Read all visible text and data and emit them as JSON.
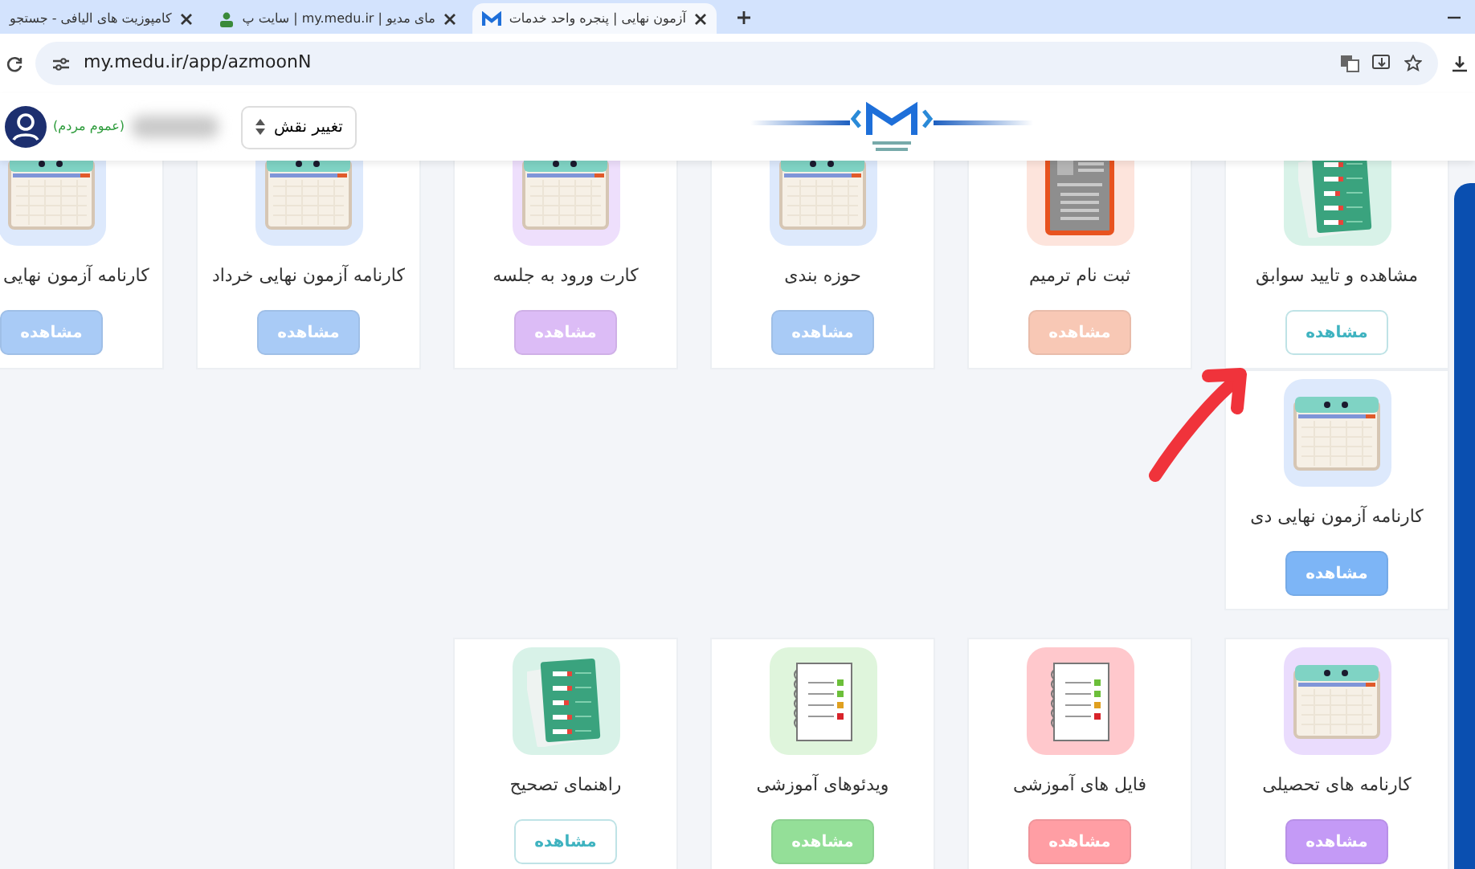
{
  "browser": {
    "tabs": [
      {
        "title": "آزمون نهایی | پنجره واحد خدمات",
        "selected": true,
        "kind": "logo"
      },
      {
        "title": "مای مدیو | my.medu.ir | سایت پ",
        "selected": false,
        "kind": "person"
      },
      {
        "title": "کامپوزیت های الیافی - جستجو",
        "selected": false,
        "kind": "plain"
      }
    ],
    "address_bar": {
      "url": "my.medu.ir/app/azmoonN"
    }
  },
  "header": {
    "user_role": "(عموم مردم)",
    "role_button": "تغییر نقش"
  },
  "card_rows": [
    {
      "cards": [
        {
          "title": "مشاهده و تایید سوابق",
          "icon": {
            "kind": "checklist"
          },
          "color": "#d8f2e8",
          "button": {
            "label": "مشاهده",
            "kind": "outline",
            "color": "#3fb3c0"
          }
        },
        {
          "title": "ثبت نام ترمیم",
          "icon": {
            "kind": "report"
          },
          "color": "#fde4dc",
          "button": {
            "label": "مشاهده",
            "kind": "filled",
            "color": "#f8c8b5"
          }
        },
        {
          "title": "حوزه بندی",
          "icon": {
            "kind": "calendar"
          },
          "color": "#dde9fc",
          "button": {
            "label": "مشاهده",
            "kind": "filled",
            "color": "#a9cbf6"
          }
        },
        {
          "title": "کارت ورود به جلسه",
          "icon": {
            "kind": "calendar"
          },
          "color": "#eedffc",
          "button": {
            "label": "مشاهده",
            "kind": "filled",
            "color": "#dcbcf6"
          }
        },
        {
          "title": "کارنامه آزمون نهایی خرداد",
          "icon": {
            "kind": "calendar"
          },
          "color": "#dde9fc",
          "button": {
            "label": "مشاهده",
            "kind": "filled",
            "color": "#a9cbf6"
          }
        },
        {
          "title": "کارنامه آزمون نهایی",
          "icon": {
            "kind": "calendar"
          },
          "color": "#dde9fc",
          "button": {
            "label": "مشاهده",
            "kind": "filled",
            "color": "#a9cbf6"
          }
        }
      ]
    },
    {
      "cards": [
        {
          "title": "کارنامه آزمون نهایی دی",
          "icon": {
            "kind": "calendar"
          },
          "color": "#dde9fc",
          "button": {
            "label": "مشاهده",
            "kind": "filled",
            "color": "#7db5f6"
          }
        }
      ]
    },
    {
      "cards": [
        {
          "title": "کارنامه های تحصیلی",
          "icon": {
            "kind": "calendar"
          },
          "color": "#eadcfd",
          "button": {
            "label": "مشاهده",
            "kind": "filled",
            "color": "#c49af6"
          }
        },
        {
          "title": "فایل های آموزشی",
          "icon": {
            "kind": "notes"
          },
          "color": "#ffc8cc",
          "button": {
            "label": "مشاهده",
            "kind": "filled",
            "color": "#ff9ea4"
          }
        },
        {
          "title": "ویدئوهای آموزشی",
          "icon": {
            "kind": "notes"
          },
          "color": "#dff5dc",
          "button": {
            "label": "مشاهده",
            "kind": "filled",
            "color": "#94df98"
          }
        },
        {
          "title": "راهنمای تصحیح",
          "icon": {
            "kind": "checklist"
          },
          "color": "#d8f2e8",
          "button": {
            "label": "مشاهده",
            "kind": "outline",
            "color": "#3fb3c0"
          }
        }
      ]
    }
  ]
}
